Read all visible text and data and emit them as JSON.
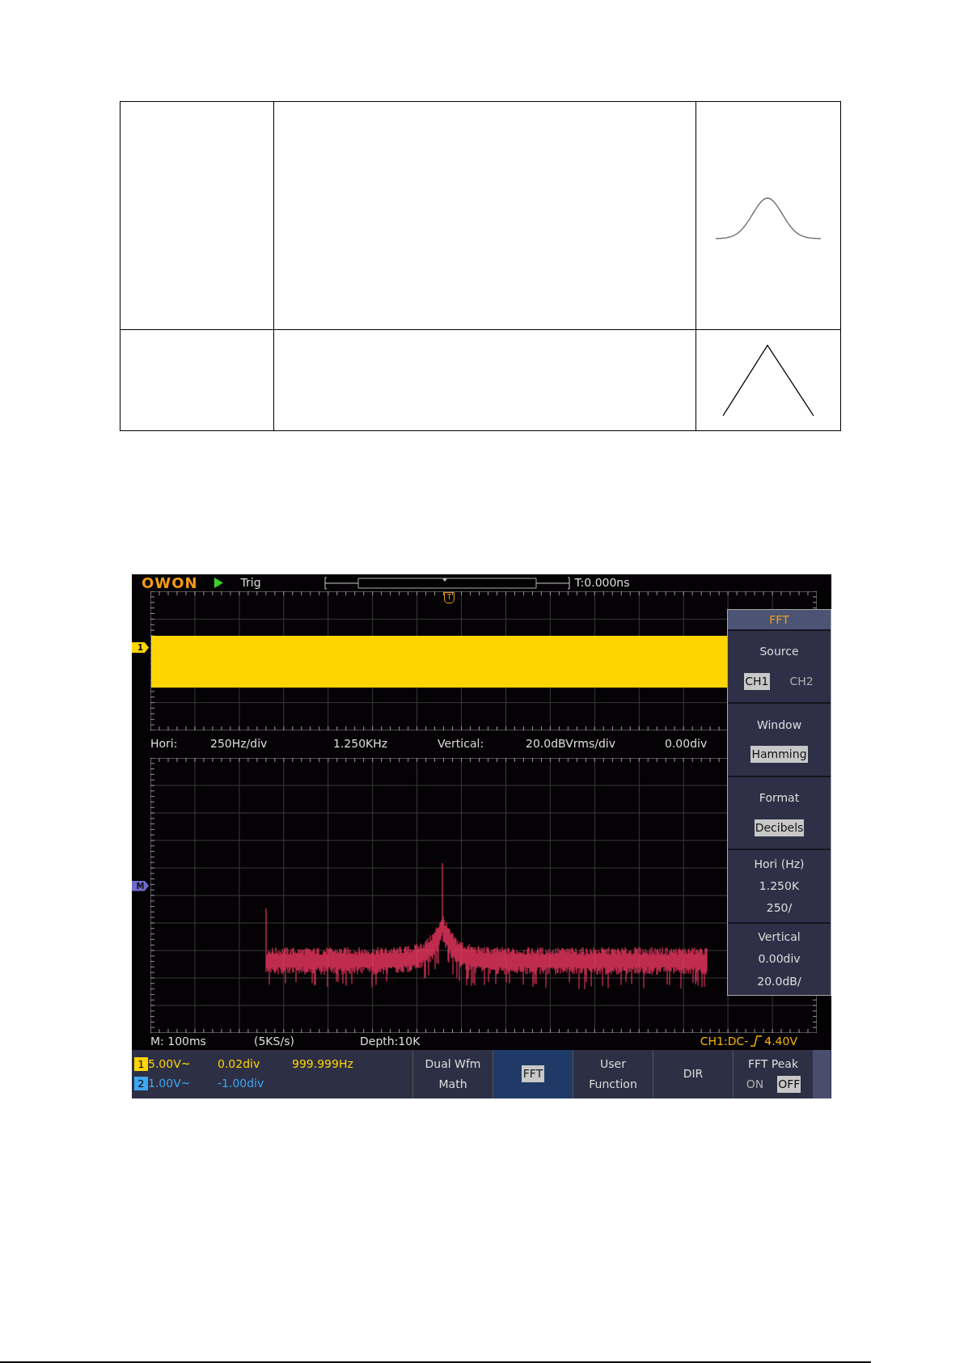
{
  "document": {
    "table": {
      "rows": [
        {
          "kind": "bell"
        },
        {
          "kind": "triangle"
        }
      ]
    }
  },
  "scope": {
    "brand": "OWON",
    "run_state": "Trig",
    "trigger_time": "T:0.000ns",
    "trigger_marker": "T",
    "ch1_marker": "1",
    "math_marker": "M",
    "info": {
      "hori_label": "Hori:",
      "hori_scale": "250Hz/div",
      "hori_center": "1.250KHz",
      "vert_label": "Vertical:",
      "vert_scale": "20.0dBVrms/div",
      "vert_offset": "0.00div"
    },
    "timebase": "M: 100ms",
    "sample_rate": "(5KS/s)",
    "depth": "Depth:10K",
    "trigger_info": "CH1:DC-",
    "trigger_level": "4.40V",
    "channels": [
      {
        "number": "1",
        "scale": "5.00V~",
        "offset": "0.02div",
        "frequency": "999.999Hz",
        "color": "#ffd400"
      },
      {
        "number": "2",
        "scale": "1.00V~",
        "offset": "-1.00div",
        "color": "#3ea6f2"
      }
    ],
    "softkeys": [
      {
        "kind": "text",
        "lines": [
          "Dual Wfm",
          "Math"
        ],
        "selected": false
      },
      {
        "kind": "boxed",
        "lines": [
          "FFT"
        ],
        "selected": true
      },
      {
        "kind": "text",
        "lines": [
          "User",
          "Function"
        ],
        "selected": false
      },
      {
        "kind": "text",
        "lines": [
          "DIR"
        ],
        "selected": false
      },
      {
        "kind": "toggle",
        "title": "FFT Peak",
        "options": [
          {
            "label": "ON",
            "selected": false
          },
          {
            "label": "OFF",
            "selected": true
          }
        ]
      }
    ],
    "side_menu": {
      "title": "FFT",
      "items": [
        {
          "kind": "options",
          "title": "Source",
          "options": [
            {
              "label": "CH1",
              "selected": true
            },
            {
              "label": "CH2",
              "selected": false
            }
          ]
        },
        {
          "kind": "options",
          "title": "Window",
          "options": [
            {
              "label": "Hamming",
              "selected": true
            }
          ]
        },
        {
          "kind": "options",
          "title": "Format",
          "options": [
            {
              "label": "Decibels",
              "selected": true
            }
          ]
        },
        {
          "kind": "values",
          "title": "Hori (Hz)",
          "values": [
            "1.250K",
            "250/"
          ]
        },
        {
          "kind": "values",
          "title": "Vertical",
          "values": [
            "0.00div",
            "20.0dB/"
          ]
        }
      ]
    }
  }
}
